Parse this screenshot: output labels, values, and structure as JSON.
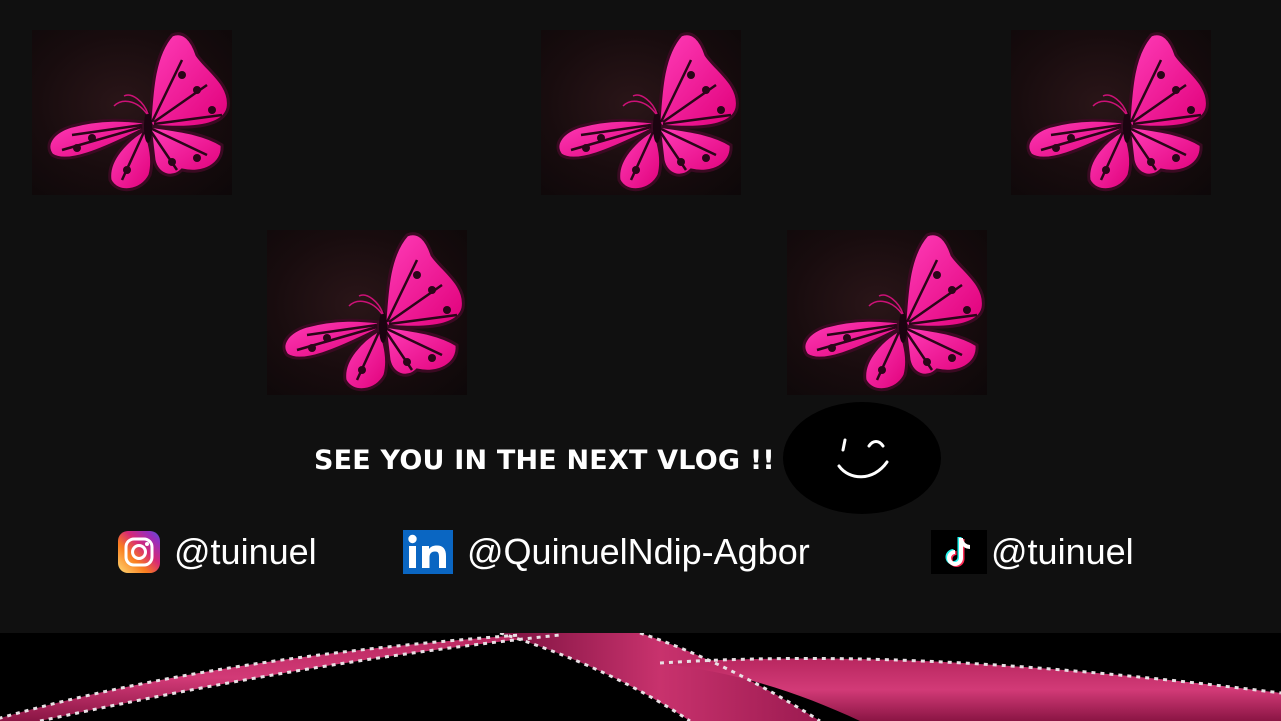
{
  "slide": {
    "headline": "SEE YOU IN THE NEXT VLOG !!",
    "accent_color": "#ff1493",
    "background_color": "#101010"
  },
  "butterflies": [
    {
      "icon": "butterfly-icon"
    },
    {
      "icon": "butterfly-icon"
    },
    {
      "icon": "butterfly-icon"
    },
    {
      "icon": "butterfly-icon"
    },
    {
      "icon": "butterfly-icon"
    }
  ],
  "socials": [
    {
      "platform_icon": "instagram-icon",
      "handle": "@tuinuel"
    },
    {
      "platform_icon": "linkedin-icon",
      "handle": "@QuinuelNdip-Agbor"
    },
    {
      "platform_icon": "tiktok-icon",
      "handle": "@tuinuel"
    }
  ],
  "decor": {
    "wink_icon": "winking-smiley-icon",
    "footer_image": "pink-ribbon-image"
  }
}
